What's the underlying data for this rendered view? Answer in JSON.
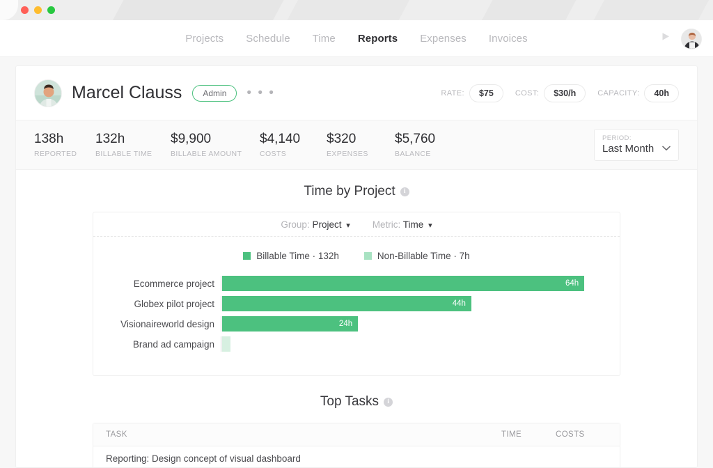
{
  "window": {
    "dots": [
      {
        "name": "close",
        "color": "#ff5f57"
      },
      {
        "name": "minimize",
        "color": "#febc2e"
      },
      {
        "name": "zoom",
        "color": "#28c840"
      }
    ]
  },
  "nav": {
    "items": [
      {
        "label": "Projects",
        "active": false
      },
      {
        "label": "Schedule",
        "active": false
      },
      {
        "label": "Time",
        "active": false
      },
      {
        "label": "Reports",
        "active": true
      },
      {
        "label": "Expenses",
        "active": false
      },
      {
        "label": "Invoices",
        "active": false
      }
    ],
    "timer_icon": "play-icon",
    "avatar_icon": "user-avatar"
  },
  "profile": {
    "name": "Marcel Clauss",
    "role_badge": "Admin",
    "more_menu": "• • •",
    "meta": [
      {
        "label": "RATE:",
        "value": "$75"
      },
      {
        "label": "COST:",
        "value": "$30/h"
      },
      {
        "label": "CAPACITY:",
        "value": "40h"
      }
    ]
  },
  "stats": [
    {
      "value": "138h",
      "label": "REPORTED"
    },
    {
      "value": "132h",
      "label": "BILLABLE TIME"
    },
    {
      "value": "$9,900",
      "label": "BILLABLE AMOUNT"
    },
    {
      "value": "$4,140",
      "label": "COSTS"
    },
    {
      "value": "$320",
      "label": "EXPENSES"
    },
    {
      "value": "$5,760",
      "label": "BALANCE"
    }
  ],
  "period": {
    "label": "PERIOD:",
    "value": "Last Month",
    "chevron": "⌄"
  },
  "time_by_project": {
    "title": "Time by Project",
    "info": "i",
    "controls": [
      {
        "label": "Group:",
        "value": "Project",
        "chevron": "⌵"
      },
      {
        "label": "Metric:",
        "value": "Time",
        "chevron": "⌵"
      }
    ]
  },
  "top_tasks": {
    "title": "Top Tasks",
    "info": "i",
    "columns": {
      "task": "TASK",
      "time": "TIME",
      "costs": "COSTS"
    },
    "rows": [
      {
        "task": "Reporting: Design concept of visual dashboard",
        "time": "",
        "costs": ""
      }
    ]
  },
  "chart_data": {
    "type": "bar",
    "title": "Time by Project",
    "orientation": "horizontal",
    "xlabel": "",
    "ylabel": "",
    "grid": false,
    "legend_position": "top-center",
    "colors": {
      "billable": "#4cc17f",
      "non_billable": "#d7f0e1"
    },
    "legend": [
      {
        "name": "Billable Time",
        "total": "132h",
        "color": "#4cc17f"
      },
      {
        "name": "Non-Billable Time",
        "total": "7h",
        "color": "#d7f0e1"
      }
    ],
    "categories": [
      "Ecommerce project",
      "Globex pilot project",
      "Visionaireworld design",
      "Brand ad campaign"
    ],
    "series": [
      {
        "name": "Billable Time",
        "values": [
          64,
          44,
          24,
          0
        ],
        "labels": [
          "64h",
          "44h",
          "24h",
          ""
        ]
      },
      {
        "name": "Non-Billable Time",
        "values": [
          0,
          0,
          0,
          2
        ],
        "labels": [
          "",
          "",
          "",
          ""
        ]
      }
    ],
    "value_unit": "h",
    "xlim": [
      0,
      68
    ]
  }
}
